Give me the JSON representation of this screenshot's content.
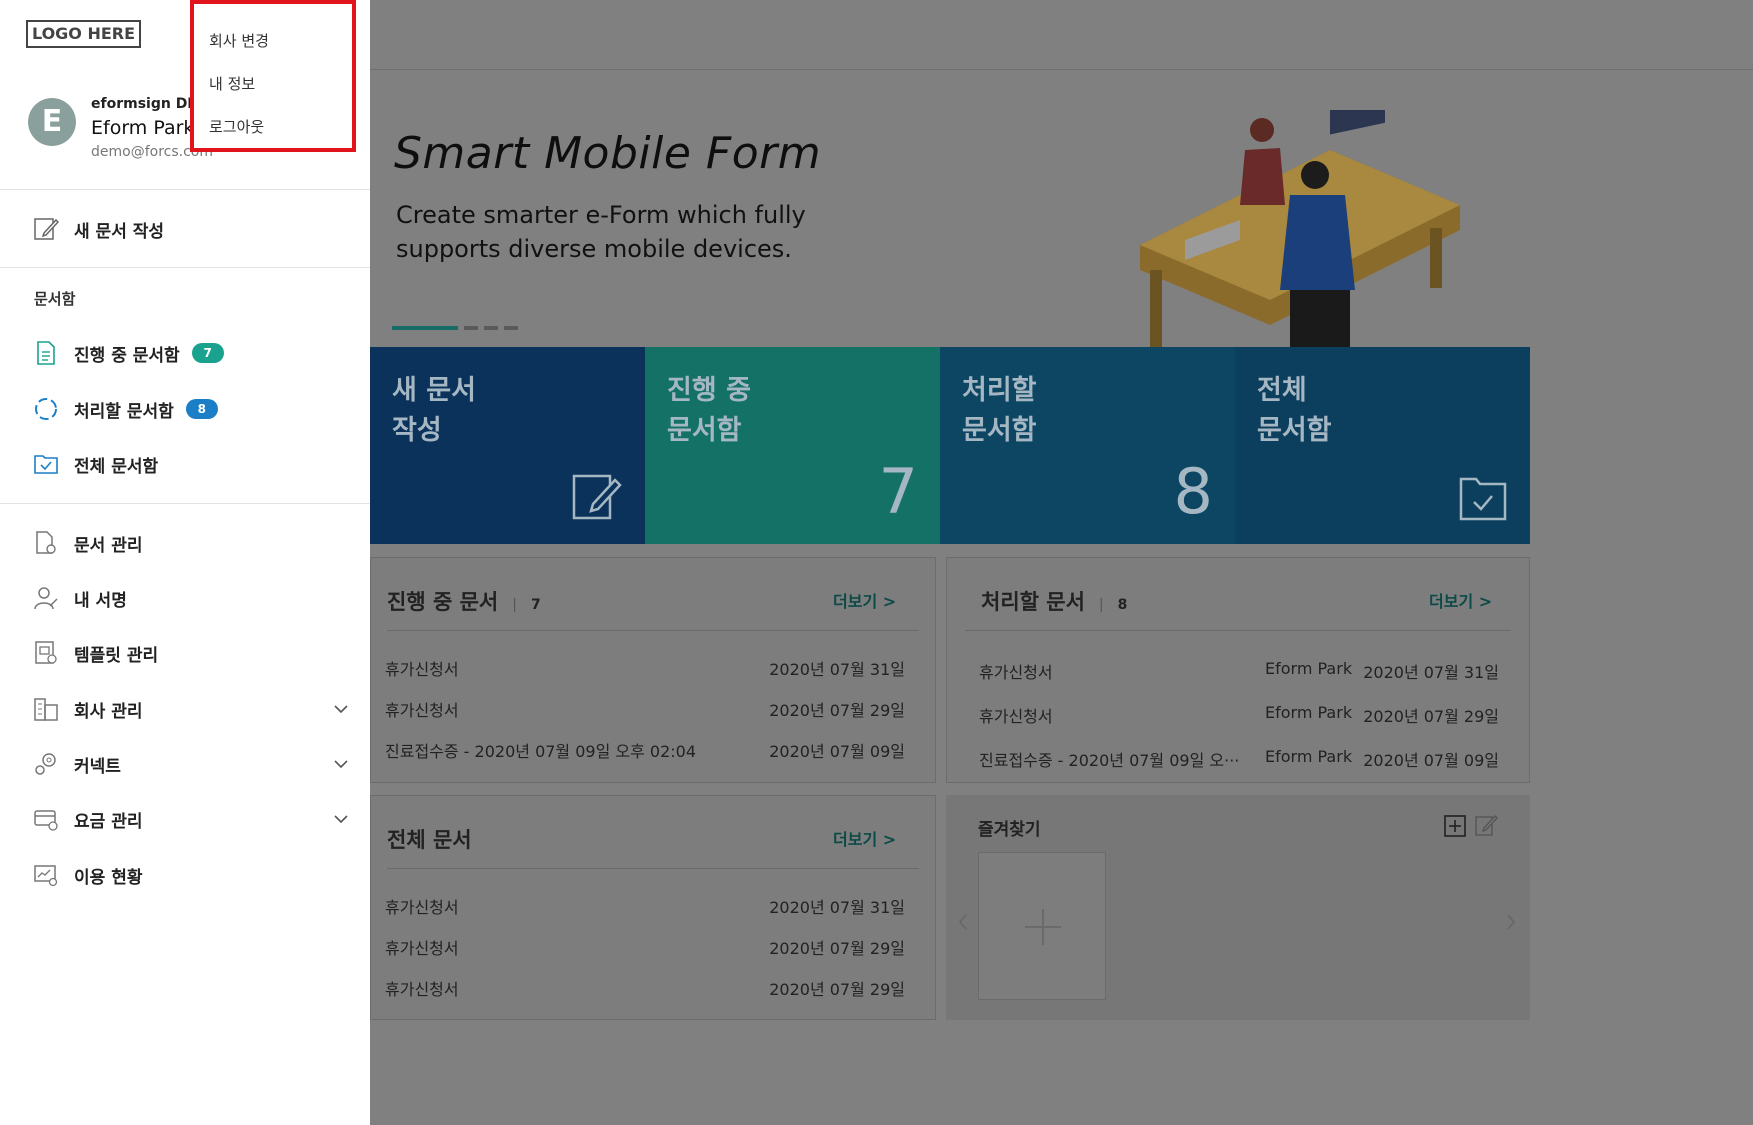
{
  "logo": "LOGO HERE",
  "profile": {
    "avatar_letter": "E",
    "company": "eformsign DEM",
    "name": "Eform Park",
    "email": "demo@forcs.com"
  },
  "dropdown": {
    "items": [
      "회사 변경",
      "내 정보",
      "로그아웃"
    ]
  },
  "menu": {
    "new_doc": "새 문서 작성",
    "section_label": "문서함",
    "boxes": [
      {
        "label": "진행 중 문서함",
        "badge": "7",
        "badge_color": "#19a38e"
      },
      {
        "label": "처리할 문서함",
        "badge": "8",
        "badge_color": "#1b7fc7"
      },
      {
        "label": "전체 문서함"
      }
    ],
    "items": [
      "문서 관리",
      "내 서명",
      "템플릿 관리",
      "회사 관리",
      "커넥트",
      "요금 관리",
      "이용 현황"
    ]
  },
  "banner": {
    "title": "Smart Mobile Form",
    "subtitle": "Create smarter e-Form which fully supports diverse mobile devices."
  },
  "tiles": [
    {
      "title_line1": "새 문서",
      "title_line2": "작성",
      "color": "#0b325a"
    },
    {
      "title_line1": "진행 중",
      "title_line2": "문서함",
      "value": "7",
      "color": "#137165"
    },
    {
      "title_line1": "처리할",
      "title_line2": "문서함",
      "value": "8",
      "color": "#0c4663"
    },
    {
      "title_line1": "전체",
      "title_line2": "문서함",
      "color": "#0c3f5d"
    }
  ],
  "panels": {
    "in_progress": {
      "title": "진행 중 문서",
      "count": "7",
      "more": "더보기 >",
      "rows": [
        {
          "name": "휴가신청서",
          "date": "2020년 07월 31일"
        },
        {
          "name": "휴가신청서",
          "date": "2020년 07월 29일"
        },
        {
          "name": "진료접수증 - 2020년 07월 09일 오후 02:04",
          "date": "2020년 07월 09일"
        }
      ]
    },
    "to_process": {
      "title": "처리할 문서",
      "count": "8",
      "more": "더보기 >",
      "rows": [
        {
          "name": "휴가신청서",
          "author": "Eform Park",
          "date": "2020년 07월 31일"
        },
        {
          "name": "휴가신청서",
          "author": "Eform Park",
          "date": "2020년 07월 29일"
        },
        {
          "name": "진료접수증 - 2020년 07월 09일 오···",
          "author": "Eform Park",
          "date": "2020년 07월 09일"
        }
      ]
    },
    "all": {
      "title": "전체 문서",
      "more": "더보기 >",
      "rows": [
        {
          "name": "휴가신청서",
          "date": "2020년 07월 31일"
        },
        {
          "name": "휴가신청서",
          "date": "2020년 07월 29일"
        },
        {
          "name": "휴가신청서",
          "date": "2020년 07월 29일"
        }
      ]
    },
    "favorites": {
      "title": "즐겨찾기"
    }
  }
}
